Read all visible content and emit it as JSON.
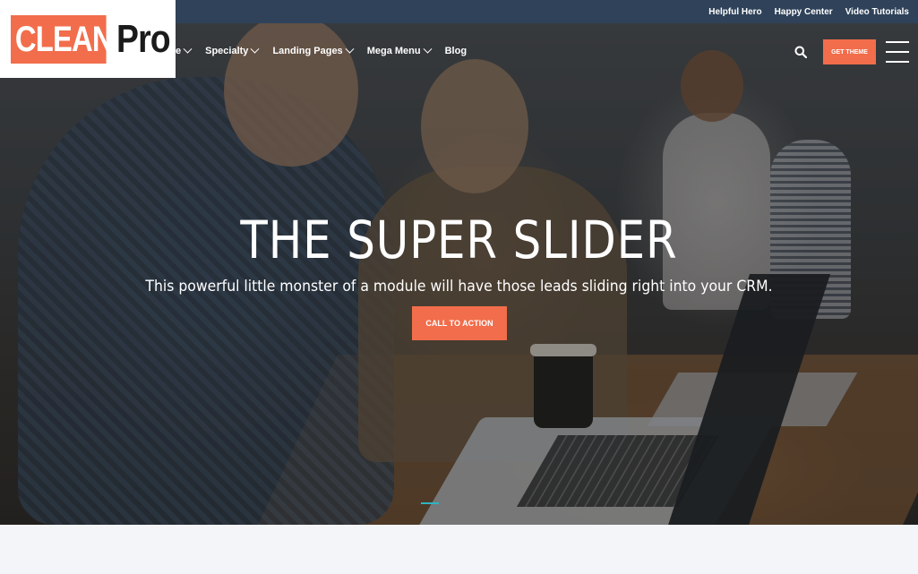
{
  "utility_bar": {
    "links": [
      "Helpful Hero",
      "Happy Center",
      "Video Tutorials"
    ]
  },
  "logo": {
    "box_text": "CLEAN",
    "word": "Pro"
  },
  "nav": {
    "items": [
      {
        "label": "e",
        "dropdown": true
      },
      {
        "label": "Specialty",
        "dropdown": true
      },
      {
        "label": "Landing Pages",
        "dropdown": true
      },
      {
        "label": "Mega Menu",
        "dropdown": true
      },
      {
        "label": "Blog",
        "dropdown": false
      }
    ],
    "get_theme_label": "GET THEME"
  },
  "hero": {
    "title": "THE SUPER SLIDER",
    "subtitle": "This powerful little monster of a module will have those leads sliding right into your CRM.",
    "cta_label": "CALL TO ACTION"
  },
  "colors": {
    "accent": "#f26d4b",
    "topbar": "#2f4259",
    "slider_dot": "#2fb3c4"
  },
  "icons": {
    "search": "search-icon",
    "menu": "hamburger-menu-icon",
    "dropdown": "chevron-down-icon"
  }
}
